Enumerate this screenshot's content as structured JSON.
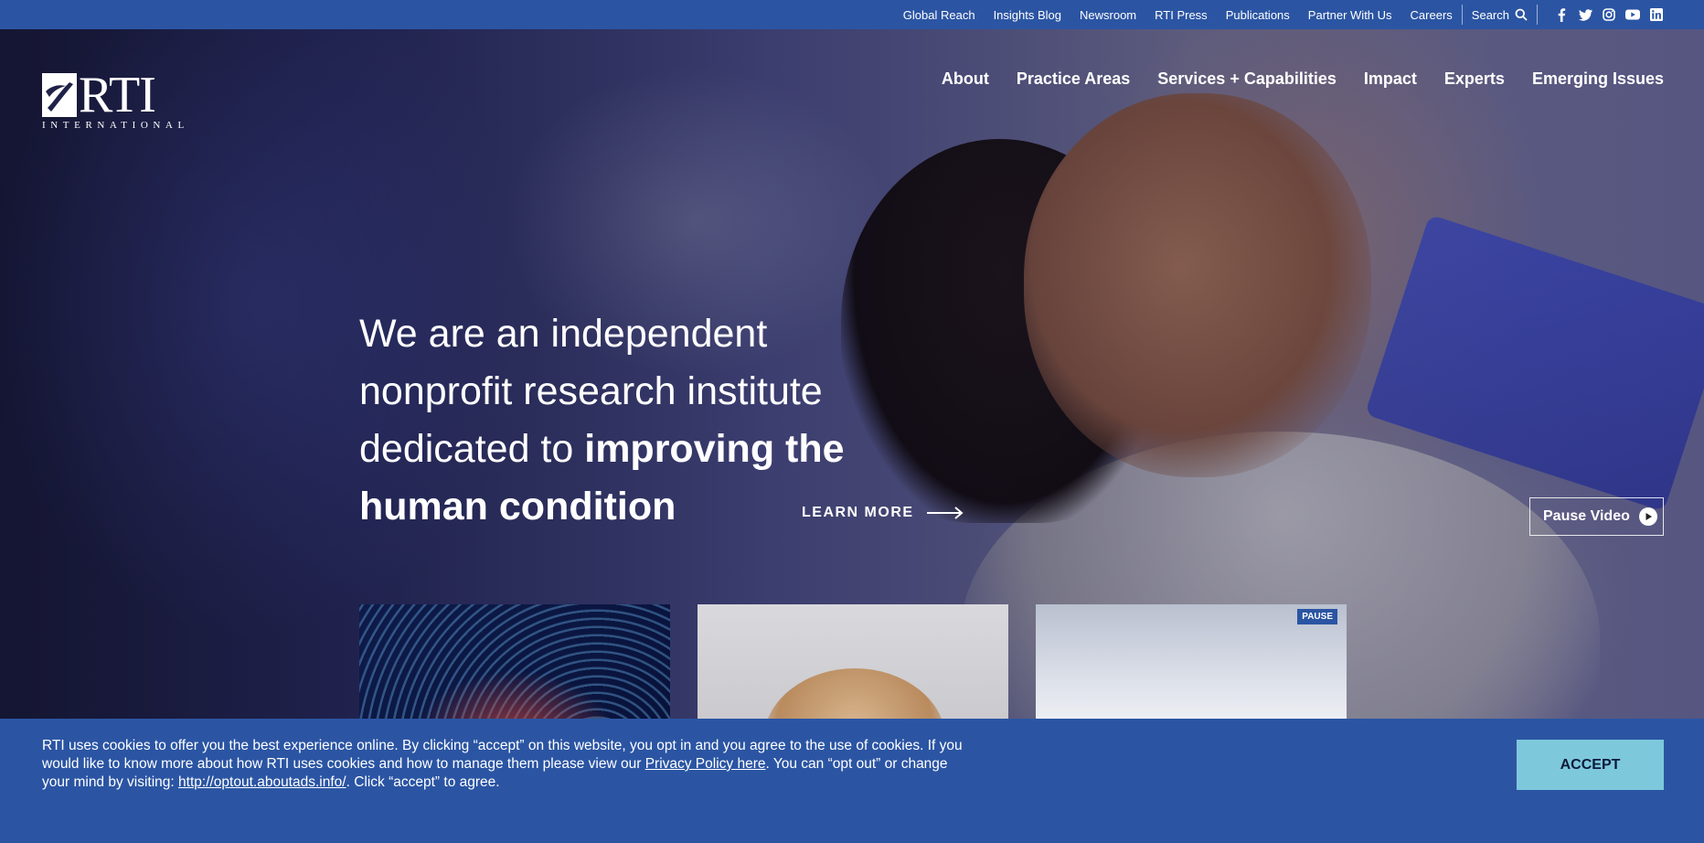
{
  "utility_nav": {
    "links": [
      "Global Reach",
      "Insights Blog",
      "Newsroom",
      "RTI Press",
      "Publications",
      "Partner With Us",
      "Careers"
    ],
    "search_label": "Search",
    "social_icons": [
      "facebook-icon",
      "twitter-icon",
      "instagram-icon",
      "youtube-icon",
      "linkedin-icon"
    ]
  },
  "logo": {
    "wordmark": "RTI",
    "subtitle": "INTERNATIONAL"
  },
  "main_nav": {
    "items": [
      "About",
      "Practice Areas",
      "Services + Capabilities",
      "Impact",
      "Experts",
      "Emerging Issues"
    ]
  },
  "hero": {
    "headline_regular": "We are an independent nonprofit research institute dedicated to",
    "headline_bold": "improving the human condition",
    "learn_more": "LEARN MORE",
    "pause_video": "Pause Video"
  },
  "cards": {
    "pause_badge": "PAUSE"
  },
  "cookie_banner": {
    "text_part1": "RTI uses cookies to offer you the best experience online. By clicking “accept” on this website, you opt in and you agree to the use of cookies. If you would like to know more about how RTI uses cookies and how to manage them please view our ",
    "privacy_link": "Privacy Policy here",
    "text_part2": ". You can “opt out” or change your mind by visiting: ",
    "optout_link": "http://optout.aboutads.info/",
    "text_part3": ". Click “accept” to agree.",
    "accept_label": "ACCEPT"
  },
  "colors": {
    "brand_blue": "#2b55a3",
    "accept_button": "#7ec8dc"
  }
}
